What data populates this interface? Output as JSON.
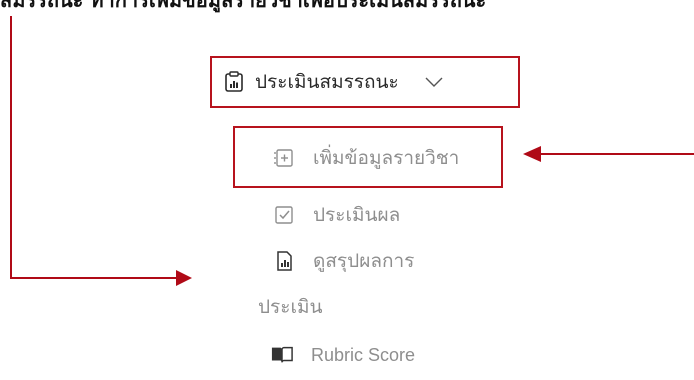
{
  "caption": {
    "text": "สมรรถนะ ทำการเพิ่มข้อมูลรายวิชาเพื่อประเมินสมรรถนะ"
  },
  "menu": {
    "group": {
      "label": "ประเมินสมรรถนะ",
      "icon": "clipboard-chart-icon",
      "chevron": "chevron-down-icon",
      "expanded": true
    },
    "items": [
      {
        "label": "เพิ่มข้อมูลรายวิชา",
        "icon": "add-list-icon",
        "highlighted": true
      },
      {
        "label": "ประเมินผล",
        "icon": "checkbox-icon",
        "highlighted": false
      },
      {
        "label_line1": "ดูสรุปผลการ",
        "label_line2": "ประเมิน",
        "icon": "document-chart-icon",
        "highlighted": false
      },
      {
        "label": "Rubric Score",
        "icon": "book-icon",
        "highlighted": false
      }
    ]
  },
  "colors": {
    "accent": "#b7131d",
    "muted_text": "#8e8e8e",
    "group_text": "#2a2a2a"
  }
}
